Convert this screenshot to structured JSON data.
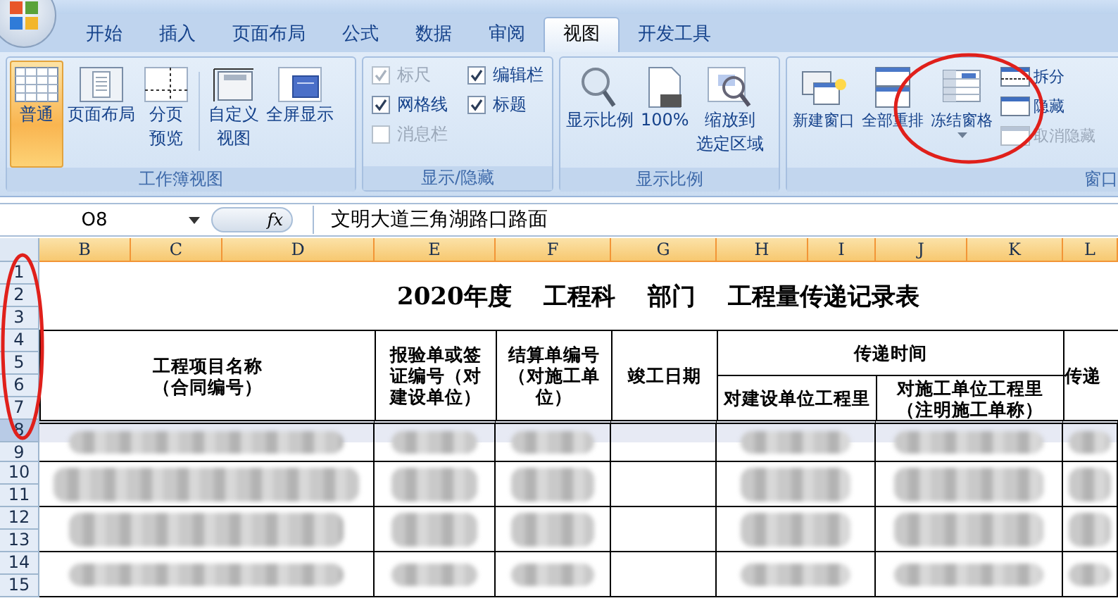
{
  "tabs": [
    {
      "label": "开始",
      "selected": false
    },
    {
      "label": "插入",
      "selected": false
    },
    {
      "label": "页面布局",
      "selected": false
    },
    {
      "label": "公式",
      "selected": false
    },
    {
      "label": "数据",
      "selected": false
    },
    {
      "label": "审阅",
      "selected": false
    },
    {
      "label": "视图",
      "selected": true
    },
    {
      "label": "开发工具",
      "selected": false
    }
  ],
  "ribbon_groups": [
    {
      "title": "工作簿视图",
      "kind": "buttons",
      "items": [
        {
          "label": "普通",
          "selected": true
        },
        {
          "label": "页面布局",
          "selected": false
        },
        {
          "label": "分页",
          "label_line2": "预览",
          "selected": false
        },
        {
          "label": "自定义",
          "label_line2": "视图",
          "selected": false
        },
        {
          "label": "全屏显示",
          "selected": false
        }
      ]
    },
    {
      "title": "显示/隐藏",
      "kind": "checkboxes",
      "items": [
        {
          "label": "标尺",
          "checked": true,
          "disabled": true
        },
        {
          "label": "编辑栏",
          "checked": true,
          "disabled": false
        },
        {
          "label": "网格线",
          "checked": true,
          "disabled": false
        },
        {
          "label": "标题",
          "checked": true,
          "disabled": false
        },
        {
          "label": "消息栏",
          "checked": false,
          "disabled": true
        }
      ]
    },
    {
      "title": "显示比例",
      "kind": "buttons",
      "items": [
        {
          "label": "显示比例",
          "selected": false
        },
        {
          "label": "100%",
          "selected": false
        },
        {
          "label": "缩放到",
          "label_line2": "选定区域",
          "selected": false
        }
      ]
    },
    {
      "title": "窗口",
      "kind": "window",
      "items": [
        {
          "label": "新建窗口",
          "selected": false
        },
        {
          "label": "全部重排",
          "selected": false
        },
        {
          "label": "冻结窗格",
          "selected": false
        }
      ],
      "small_items": [
        {
          "label": "拆分",
          "disabled": false
        },
        {
          "label": "隐藏",
          "disabled": false
        },
        {
          "label": "取消隐藏",
          "disabled": true
        }
      ]
    }
  ],
  "formula_bar": {
    "name_box": "O8",
    "fx": "fx",
    "formula": "文明大道三角湖路口路面"
  },
  "sheet": {
    "columns": [
      {
        "label": "B",
        "highlighted": true
      },
      {
        "label": "C",
        "highlighted": true
      },
      {
        "label": "D",
        "highlighted": true
      },
      {
        "label": "E",
        "highlighted": true
      },
      {
        "label": "F",
        "highlighted": true
      },
      {
        "label": "G",
        "highlighted": true
      },
      {
        "label": "H",
        "highlighted": true
      },
      {
        "label": "I",
        "highlighted": true
      },
      {
        "label": "J",
        "highlighted": true
      },
      {
        "label": "K",
        "highlighted": true
      },
      {
        "label": "L",
        "highlighted": true
      }
    ],
    "rows": [
      {
        "label": "1",
        "selected": false
      },
      {
        "label": "2",
        "selected": false
      },
      {
        "label": "3",
        "selected": false
      },
      {
        "label": "4",
        "selected": false
      },
      {
        "label": "5",
        "selected": false
      },
      {
        "label": "6",
        "selected": false
      },
      {
        "label": "7",
        "selected": false
      },
      {
        "label": "8",
        "selected": true
      },
      {
        "label": "9",
        "selected": false
      },
      {
        "label": "10",
        "selected": false
      },
      {
        "label": "11",
        "selected": false
      },
      {
        "label": "12",
        "selected": false
      },
      {
        "label": "13",
        "selected": false
      },
      {
        "label": "14",
        "selected": false
      },
      {
        "label": "15",
        "selected": false
      }
    ],
    "title": "2020年度　 工程科　 部门　 工程量传递记录表",
    "headers": [
      [
        "工程项目名称",
        "（合同编号）"
      ],
      [
        "报验单或签",
        "证编号（对",
        "建设单位）"
      ],
      [
        "结算单编号",
        "（对施工单",
        "位）"
      ],
      [
        "竣工日期"
      ],
      [
        "传递时间"
      ],
      [
        "对建设单位工程里"
      ],
      [
        "对施工单位工程里",
        "（注明施工单称）"
      ],
      [
        "传递"
      ]
    ]
  }
}
